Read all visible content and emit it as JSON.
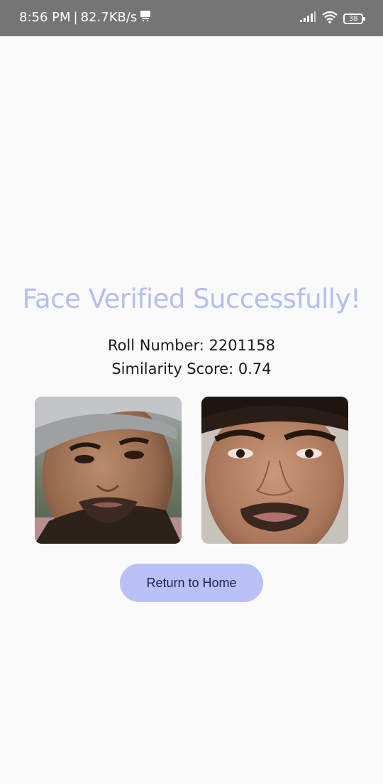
{
  "status_bar": {
    "time": "8:56 PM",
    "separator": "|",
    "network_speed": "82.7KB/s",
    "battery_level": "38",
    "icons": [
      "notification-icon",
      "signal-icon",
      "wifi-icon",
      "battery-icon"
    ]
  },
  "main": {
    "title": "Face Verified Successfully!",
    "roll_number_text": "Roll Number: 2201158",
    "similarity_score_text": "Similarity Score: 0.74",
    "photos": [
      "captured-face-photo",
      "reference-face-photo"
    ],
    "return_button_label": "Return to Home"
  },
  "colors": {
    "status_bar_bg": "#757575",
    "title": "#b5bef0",
    "button_bg": "#bac1f4",
    "button_text": "#1f1f5c",
    "page_bg": "#fafafa"
  }
}
